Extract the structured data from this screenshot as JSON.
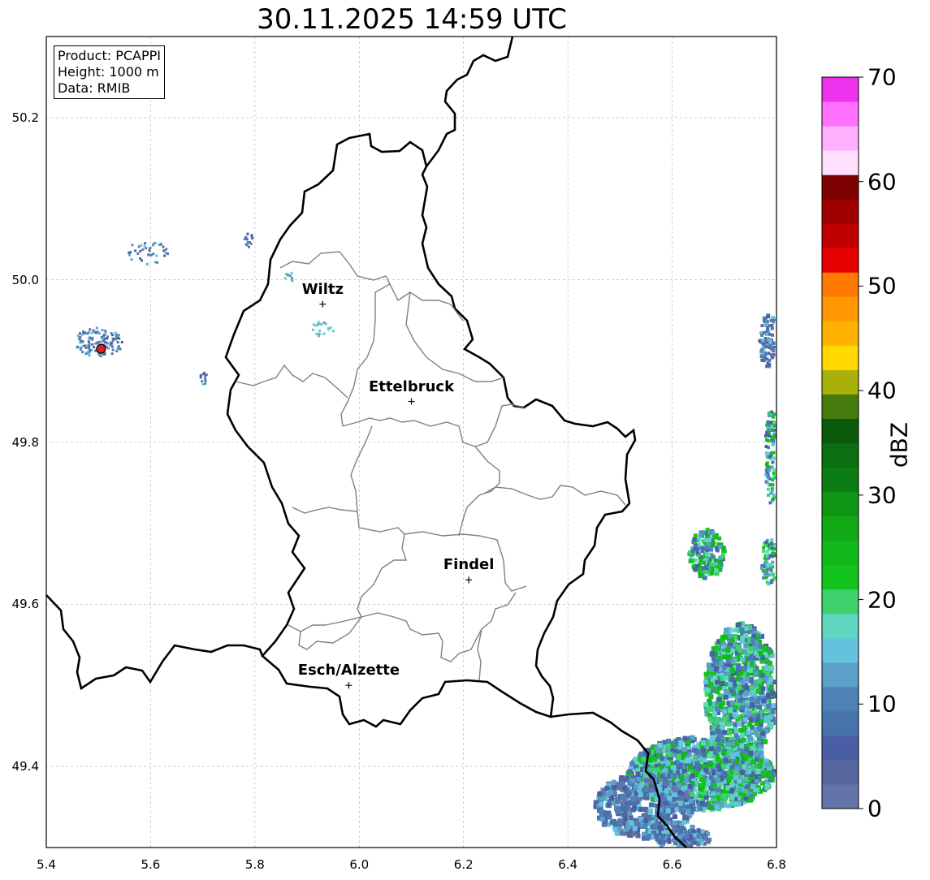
{
  "title": "30.11.2025 14:59 UTC",
  "info": {
    "product": "Product: PCAPPI",
    "height": "Height: 1000 m",
    "data": "Data: RMIB"
  },
  "axes": {
    "x_ticks": [
      "5.4",
      "5.6",
      "5.8",
      "6.0",
      "6.2",
      "6.4",
      "6.6",
      "6.8"
    ],
    "y_ticks": [
      "50.2",
      "50.0",
      "49.8",
      "49.6",
      "49.4"
    ],
    "xlim": [
      5.4,
      6.8
    ],
    "ylim": [
      49.3,
      50.3
    ],
    "grid": true
  },
  "colorbar": {
    "label": "dBZ",
    "ticks": [
      "0",
      "10",
      "20",
      "30",
      "40",
      "50",
      "60",
      "70"
    ],
    "range": [
      0,
      70
    ],
    "colors": [
      "#6375a8",
      "#56679f",
      "#4a5ea5",
      "#4773ad",
      "#4e82b6",
      "#5aa0c8",
      "#63c3dc",
      "#5fd6c0",
      "#3dd26c",
      "#13c41d",
      "#12b91a",
      "#11a916",
      "#0f9614",
      "#0c7d12",
      "#0b6e10",
      "#0b5a0c",
      "#477a0c",
      "#aab00a",
      "#ffd800",
      "#ffb300",
      "#ff9800",
      "#ff7a00",
      "#e60000",
      "#c00000",
      "#a00000",
      "#7d0000",
      "#ffe0ff",
      "#ffb0ff",
      "#ff70ff",
      "#ee33ee"
    ]
  },
  "cities": [
    {
      "name": "Wiltz",
      "lon": 5.93,
      "lat": 49.97
    },
    {
      "name": "Ettelbruck",
      "lon": 6.1,
      "lat": 49.85
    },
    {
      "name": "Findel",
      "lon": 6.21,
      "lat": 49.63
    },
    {
      "name": "Esch/Alzette",
      "lon": 5.98,
      "lat": 49.5
    }
  ],
  "radar_site": {
    "lon": 5.505,
    "lat": 49.915,
    "color": "#e02020"
  }
}
